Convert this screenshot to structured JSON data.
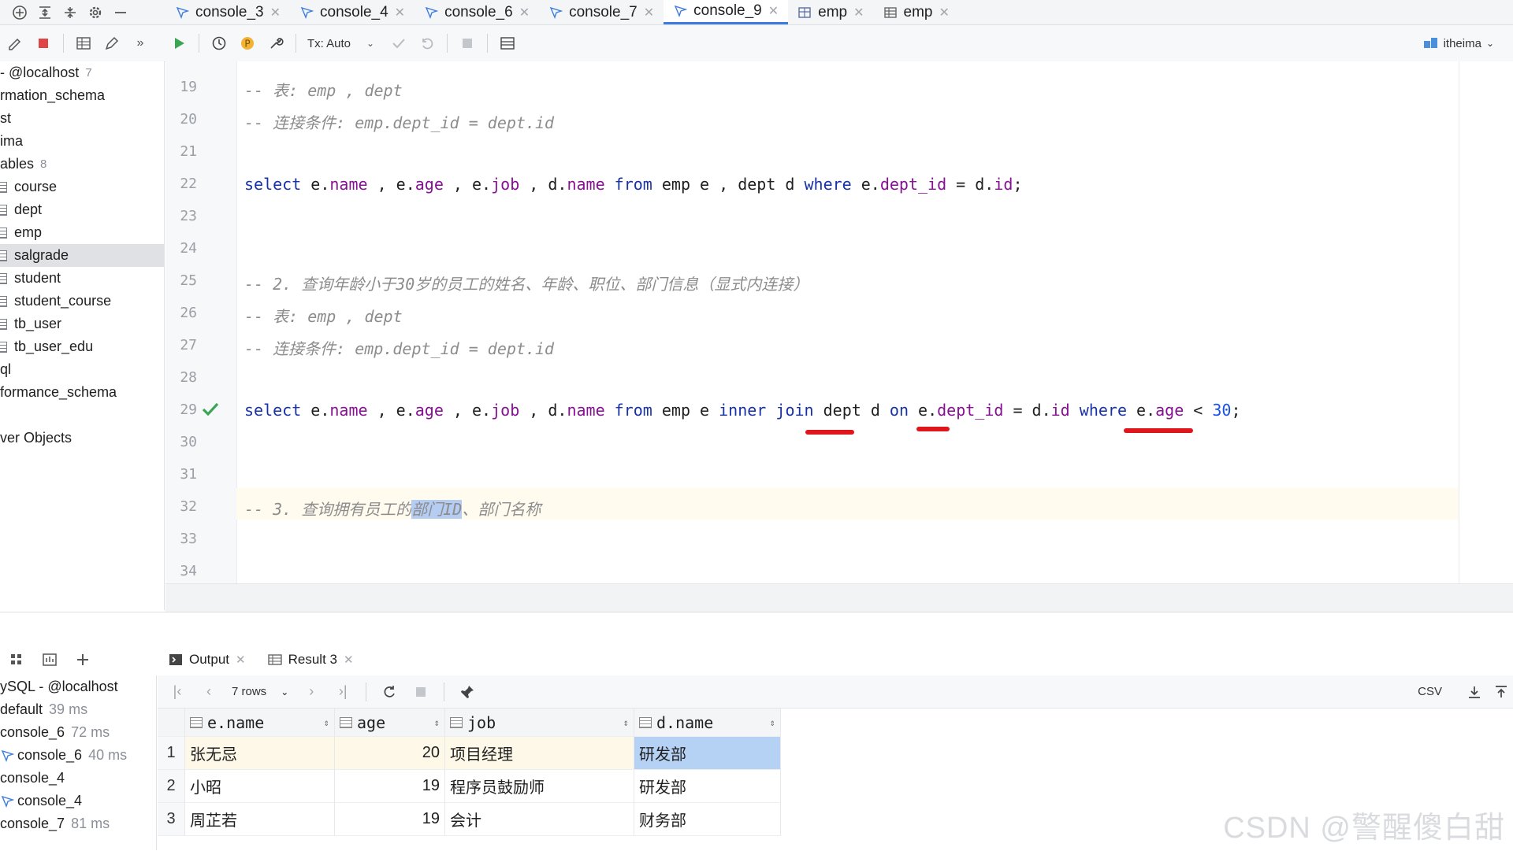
{
  "top_tabs": [
    {
      "label": "console_3",
      "type": "console",
      "active": false
    },
    {
      "label": "console_4",
      "type": "console",
      "active": false
    },
    {
      "label": "console_6",
      "type": "console",
      "active": false
    },
    {
      "label": "console_7",
      "type": "console",
      "active": false
    },
    {
      "label": "console_9",
      "type": "console",
      "active": true
    },
    {
      "label": "emp",
      "type": "table-edit",
      "active": false
    },
    {
      "label": "emp",
      "type": "table",
      "active": false
    }
  ],
  "toolbar": {
    "tx_mode": "Tx: Auto",
    "user": "itheima"
  },
  "tree": {
    "items": [
      {
        "label": "- @localhost",
        "count": "7"
      },
      {
        "label": "rmation_schema"
      },
      {
        "label": "st"
      },
      {
        "label": "ima"
      },
      {
        "label": "ables",
        "count": "8"
      },
      {
        "label": "course",
        "table": true
      },
      {
        "label": "dept",
        "table": true
      },
      {
        "label": "emp",
        "table": true
      },
      {
        "label": "salgrade",
        "table": true,
        "selected": true
      },
      {
        "label": "student",
        "table": true
      },
      {
        "label": "student_course",
        "table": true
      },
      {
        "label": "tb_user",
        "table": true
      },
      {
        "label": "tb_user_edu",
        "table": true
      },
      {
        "label": "ql"
      },
      {
        "label": "formance_schema"
      },
      {
        "label": ""
      },
      {
        "label": "ver Objects"
      }
    ]
  },
  "editor": {
    "line_numbers": [
      "19",
      "20",
      "21",
      "22",
      "23",
      "24",
      "25",
      "26",
      "27",
      "28",
      "29",
      "30",
      "31",
      "32",
      "33",
      "34"
    ],
    "l19": "-- 表: emp , dept",
    "l20": "-- 连接条件: emp.dept_id = dept.id",
    "l25": "-- 2. 查询年龄小于30岁的员工的姓名、年龄、职位、部门信息（显式内连接）",
    "l26": "-- 表: emp , dept",
    "l27": "-- 连接条件: emp.dept_id = dept.id",
    "l32_pre": "-- 3. 查询拥有员工的",
    "l32_sel": "部门ID",
    "l32_post": "、部门名称",
    "kw_select": "select",
    "kw_from": "from",
    "kw_where": "where",
    "kw_inner": "inner",
    "kw_join": "join",
    "kw_on": "on",
    "num_30": "30"
  },
  "bottom": {
    "tabs": [
      {
        "label": "Output"
      },
      {
        "label": "Result 3"
      }
    ],
    "services": [
      {
        "label": "ySQL - @localhost",
        "ms": ""
      },
      {
        "label": "default",
        "ms": "39 ms"
      },
      {
        "label": "console_6",
        "ms": "72 ms"
      },
      {
        "label": "console_6",
        "ms": "40 ms"
      },
      {
        "label": "console_4",
        "ms": ""
      },
      {
        "label": "console_4",
        "ms": ""
      },
      {
        "label": "console_7",
        "ms": "81 ms"
      }
    ],
    "rows_label": "7 rows",
    "export_format": "CSV"
  },
  "result": {
    "columns": [
      "e.name",
      "age",
      "job",
      "d.name"
    ],
    "rows": [
      {
        "n": "1",
        "name": "张无忌",
        "age": "20",
        "job": "项目经理",
        "dept": "研发部"
      },
      {
        "n": "2",
        "name": "小昭",
        "age": "19",
        "job": "程序员鼓励师",
        "dept": "研发部"
      },
      {
        "n": "3",
        "name": "周芷若",
        "age": "19",
        "job": "会计",
        "dept": "财务部"
      }
    ]
  },
  "watermark": "CSDN @警醒傻白甜"
}
